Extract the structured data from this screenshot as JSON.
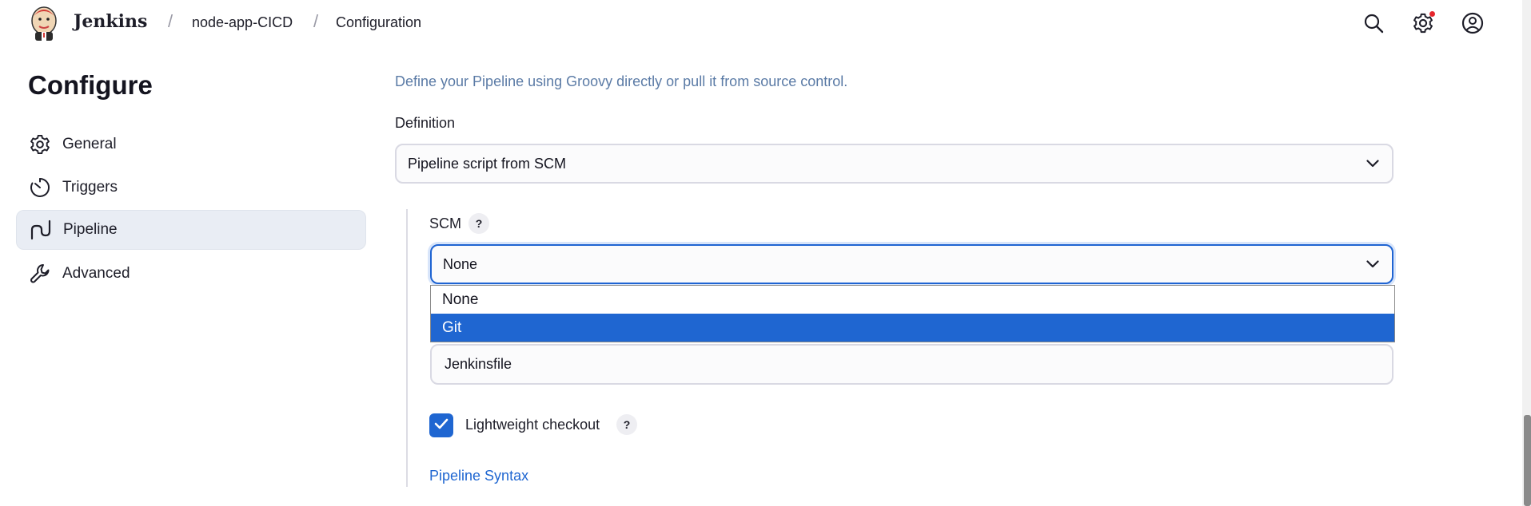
{
  "header": {
    "brand": "Jenkins",
    "breadcrumb": [
      "node-app-CICD",
      "Configuration"
    ],
    "separator": "/",
    "icons": [
      "search-icon",
      "gear-icon",
      "user-icon"
    ]
  },
  "sidebar": {
    "title": "Configure",
    "items": [
      {
        "label": "General",
        "icon": "gear-icon",
        "active": false
      },
      {
        "label": "Triggers",
        "icon": "timer-icon",
        "active": false
      },
      {
        "label": "Pipeline",
        "icon": "pipeline-icon",
        "active": true
      },
      {
        "label": "Advanced",
        "icon": "wrench-icon",
        "active": false
      }
    ]
  },
  "main": {
    "description": "Define your Pipeline using Groovy directly or pull it from source control.",
    "definition": {
      "label": "Definition",
      "value": "Pipeline script from SCM"
    },
    "scm": {
      "label": "SCM",
      "help": "?",
      "value": "None",
      "options": [
        "None",
        "Git"
      ],
      "highlighted": "Git"
    },
    "script_path": {
      "value": "Jenkinsfile"
    },
    "lightweight": {
      "label": "Lightweight checkout",
      "checked": true,
      "help": "?"
    },
    "pipeline_syntax": "Pipeline Syntax"
  },
  "colors": {
    "accent": "#1f66d1",
    "description": "#5b7ba6",
    "active_bg": "#e9edf4",
    "notification": "#e5262c"
  }
}
